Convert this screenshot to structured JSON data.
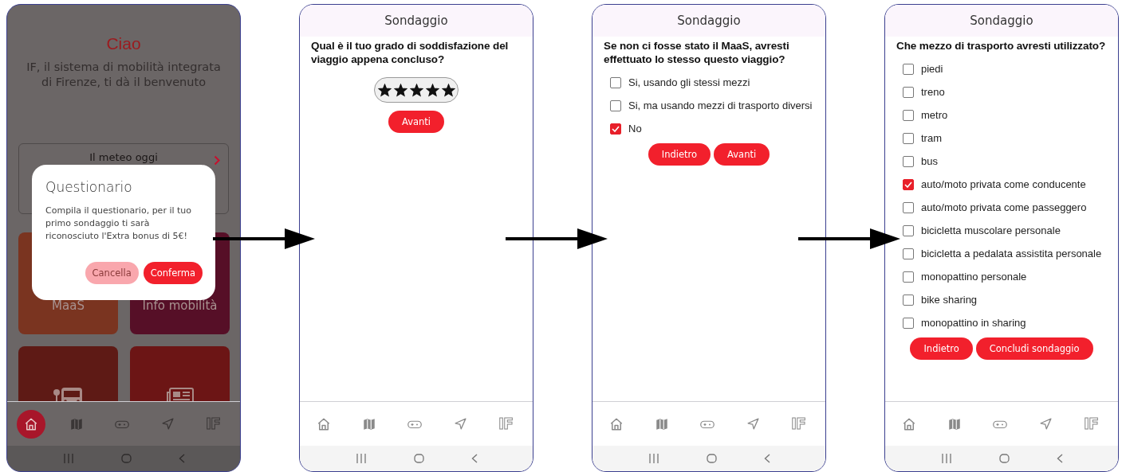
{
  "screens": [
    {
      "kind": "home",
      "dimmed": true,
      "greeting": "Ciao",
      "subtitle": "IF, il sistema di mobilità integrata di Firenze, ti dà il benvenuto",
      "weather_card": {
        "label": "Il meteo oggi"
      },
      "tiles": [
        {
          "kind": "label",
          "label": "MaaS",
          "color": "#7a3420"
        },
        {
          "kind": "label",
          "label": "Info mobilità",
          "color": "#560f27"
        },
        {
          "kind": "bus",
          "color": "#5e1a15"
        },
        {
          "kind": "news",
          "color": "#6c1515"
        }
      ],
      "dialog": {
        "title": "Questionario",
        "message": "Compila il questionario, per il tuo primo sondaggio ti sarà riconosciuto l'Extra bonus di 5€!",
        "buttons": [
          {
            "label": "Cancella",
            "kind": "secondary"
          },
          {
            "label": "Conferma",
            "kind": "primary"
          }
        ]
      },
      "nav": [
        {
          "kind": "home",
          "selected": true
        },
        {
          "kind": "map",
          "selected": false
        },
        {
          "kind": "gamepad",
          "selected": false
        },
        {
          "kind": "send",
          "selected": false
        },
        {
          "kind": "logo",
          "label": "IF",
          "selected": false
        }
      ]
    },
    {
      "kind": "rating",
      "header": "Sondaggio",
      "question": "Qual è il tuo grado di soddisfazione del viaggio appena concluso?",
      "stars": 5,
      "buttons": [
        {
          "label": "Avanti",
          "kind": "primary"
        }
      ],
      "nav": [
        {
          "kind": "home",
          "selected": false
        },
        {
          "kind": "map",
          "selected": false
        },
        {
          "kind": "gamepad",
          "selected": false
        },
        {
          "kind": "send",
          "selected": false
        },
        {
          "kind": "logo",
          "label": "IF",
          "selected": false
        }
      ]
    },
    {
      "kind": "choice",
      "header": "Sondaggio",
      "question": "Se non ci fosse stato il MaaS, avresti effettuato lo stesso questo viaggio?",
      "options": [
        {
          "label": "Si, usando gli stessi mezzi",
          "checked": false
        },
        {
          "label": "Si, ma usando mezzi di trasporto diversi",
          "checked": false
        },
        {
          "label": "No",
          "checked": true
        }
      ],
      "buttons": [
        {
          "label": "Indietro",
          "kind": "primary"
        },
        {
          "label": "Avanti",
          "kind": "primary"
        }
      ],
      "nav": [
        {
          "kind": "home",
          "selected": false
        },
        {
          "kind": "map",
          "selected": false
        },
        {
          "kind": "gamepad",
          "selected": false
        },
        {
          "kind": "send",
          "selected": false
        },
        {
          "kind": "logo",
          "label": "IF",
          "selected": false
        }
      ]
    },
    {
      "kind": "choice",
      "header": "Sondaggio",
      "question": "Che mezzo di trasporto avresti utilizzato?",
      "options": [
        {
          "label": "piedi",
          "checked": false
        },
        {
          "label": "treno",
          "checked": false
        },
        {
          "label": "metro",
          "checked": false
        },
        {
          "label": "tram",
          "checked": false
        },
        {
          "label": "bus",
          "checked": false
        },
        {
          "label": "auto/moto privata come conducente",
          "checked": true
        },
        {
          "label": "auto/moto privata come passeggero",
          "checked": false
        },
        {
          "label": "bicicletta muscolare personale",
          "checked": false
        },
        {
          "label": "bicicletta a pedalata assistita personale",
          "checked": false
        },
        {
          "label": "monopattino personale",
          "checked": false
        },
        {
          "label": "bike sharing",
          "checked": false
        },
        {
          "label": "monopattino in sharing",
          "checked": false
        }
      ],
      "buttons": [
        {
          "label": "Indietro",
          "kind": "primary"
        },
        {
          "label": "Concludi sondaggio",
          "kind": "primary"
        }
      ],
      "nav": [
        {
          "kind": "home",
          "selected": false
        },
        {
          "kind": "map",
          "selected": false
        },
        {
          "kind": "gamepad",
          "selected": false
        },
        {
          "kind": "send",
          "selected": false
        },
        {
          "kind": "logo",
          "label": "IF",
          "selected": false
        }
      ]
    }
  ]
}
